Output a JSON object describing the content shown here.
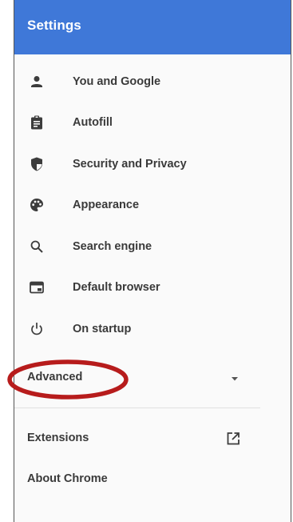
{
  "header": {
    "title": "Settings"
  },
  "nav": {
    "items": [
      {
        "label": "You and Google",
        "icon": "person-icon"
      },
      {
        "label": "Autofill",
        "icon": "clipboard-icon"
      },
      {
        "label": "Security and Privacy",
        "icon": "shield-icon"
      },
      {
        "label": "Appearance",
        "icon": "palette-icon"
      },
      {
        "label": "Search engine",
        "icon": "search-icon"
      },
      {
        "label": "Default browser",
        "icon": "browser-window-icon"
      },
      {
        "label": "On startup",
        "icon": "power-icon"
      }
    ]
  },
  "advanced": {
    "label": "Advanced",
    "icon": "dropdown-arrow-icon"
  },
  "bottom": {
    "extensions_label": "Extensions",
    "extensions_icon": "open-in-new-icon",
    "about_label": "About Chrome"
  },
  "colors": {
    "header_bg": "#3f78d8",
    "icon_color": "#3c3c3c",
    "annotation": "#b71c1c"
  }
}
